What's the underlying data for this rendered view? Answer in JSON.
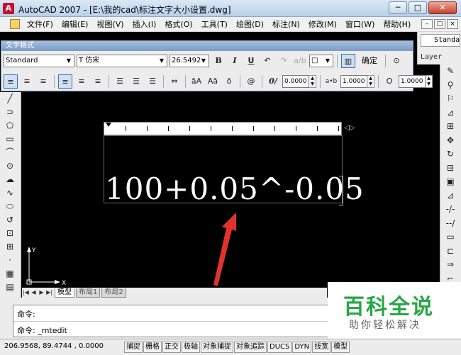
{
  "window": {
    "title": "AutoCAD 2007 - [E:\\我的cad\\标注文字大小设置.dwg]",
    "minimize": "─",
    "maximize": "□",
    "close": "✕"
  },
  "menubar": {
    "items": [
      "文件(F)",
      "编辑(E)",
      "视图(V)",
      "插入(I)",
      "格式(O)",
      "工具(T)",
      "绘图(D)",
      "标注(N)",
      "修改(M)",
      "窗口(W)",
      "帮助(H)"
    ],
    "mdi": [
      "–",
      "□",
      "×"
    ]
  },
  "right_panel": {
    "style_value": "Standa",
    "layer_label": "Layer"
  },
  "text_formatting": {
    "title": "文字格式",
    "style": "Standard",
    "font": "T 仿宋",
    "height": "26.5492",
    "bold": "B",
    "italic": "I",
    "underline": "U",
    "undo": "↶",
    "redo": "↷",
    "stack": "a/b",
    "color": "□",
    "ruler_toggle": "▥",
    "ok": "确定",
    "options": "⊙",
    "row2_buttons": [
      "≡",
      "≡",
      "≡",
      "≡",
      "≡",
      "≡",
      "☰",
      "☰",
      "☰",
      "⇔",
      "āA",
      "Aā",
      "ō",
      "@"
    ],
    "oblique": {
      "label": "0/",
      "value": "0.0000"
    },
    "tracking": {
      "label": "a•b",
      "value": "1.0000"
    },
    "width": {
      "label": "O",
      "value": "1.0000"
    }
  },
  "editor": {
    "mtext": "100+0.05^-0.05",
    "ruler_arrows": "◁▷"
  },
  "ucs": {
    "x": "X",
    "y": "Y"
  },
  "tabs": {
    "nav": [
      "|◀",
      "◀",
      "▶",
      "▶|"
    ],
    "items": [
      "模型",
      "布局1",
      "布局2"
    ]
  },
  "command": {
    "line1": "命令:",
    "line2": "命令: _mtedit"
  },
  "status": {
    "coords": "206.9568, 89.4744 , 0.0000",
    "buttons": [
      "捕捉",
      "栅格",
      "正交",
      "极轴",
      "对象捕捉",
      "对象追踪",
      "DUCS",
      "DYN",
      "线宽",
      "模型"
    ]
  },
  "watermark": {
    "title": "百科全说",
    "subtitle": "助你轻松解决"
  },
  "colors": {
    "drawing_bg": "#000000",
    "text": "#ffffff",
    "arrow": "#e0332e",
    "watermark_green": "#28a745",
    "toolbar": "#ececec"
  },
  "left_tools": [
    "╱",
    "⊿",
    "⊃",
    "⬠",
    "▭",
    "⌒",
    "⊙",
    "☁",
    "∿",
    "⬭",
    "↺",
    "⊡",
    "⊞",
    "·",
    "▦",
    "▤",
    "⊟",
    "A"
  ],
  "right_tools": [
    "✎",
    "⚲",
    "⚐",
    "⊿",
    "≙",
    "⊞",
    "✥",
    "↻",
    "⊟",
    "▣",
    "⊿",
    "-/-",
    "--/",
    "▭",
    "⊏",
    "⇒",
    "⌐",
    "⌠",
    "⊶"
  ]
}
